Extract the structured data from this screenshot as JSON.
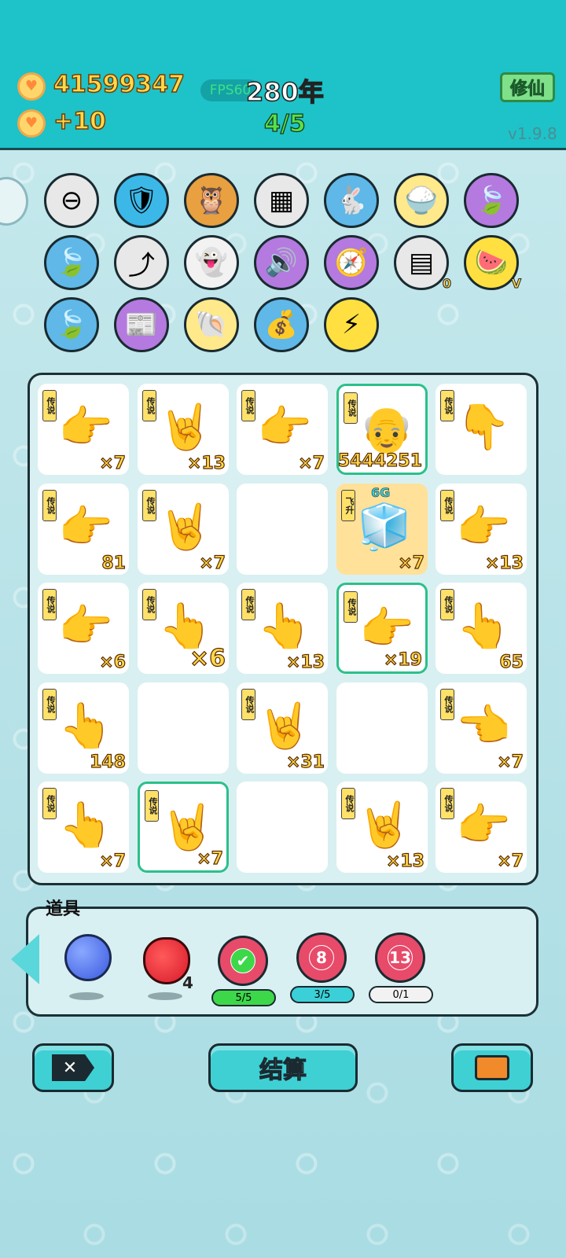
{
  "header": {
    "coins": "41599347",
    "coin_rate": "+10",
    "fps": "FPS60",
    "year": "280年",
    "progress": "4/5",
    "cultivate_button": "修仙",
    "version": "v1.9.8"
  },
  "skills": [
    {
      "icon": "minus-circle-icon",
      "glyph": "⊖",
      "bg": "#e8e8e8"
    },
    {
      "icon": "shield-wrench-icon",
      "glyph": "🛡",
      "bg": "#3bb8e8"
    },
    {
      "icon": "owl-glasses-icon",
      "glyph": "🦉",
      "bg": "#e8a040"
    },
    {
      "icon": "cubes-icon",
      "glyph": "▦",
      "bg": "#e8e8e8"
    },
    {
      "icon": "rabbit-icon",
      "glyph": "🐇",
      "bg": "#5fb8e8"
    },
    {
      "icon": "rice-bowl-icon",
      "glyph": "🍚",
      "bg": "#ffe98a"
    },
    {
      "icon": "leaf-icon",
      "glyph": "🍃",
      "bg": "#b47ae0"
    },
    {
      "icon": "leaf-icon",
      "glyph": "🍃",
      "bg": "#5fb8e8"
    },
    {
      "icon": "arrow-up-icon",
      "glyph": "⤴",
      "bg": "#e8e8e8"
    },
    {
      "icon": "ghost-icon",
      "glyph": "👻",
      "bg": "#f2f2f2"
    },
    {
      "icon": "speaker-ghost-icon",
      "glyph": "🔊",
      "bg": "#b47ae0"
    },
    {
      "icon": "compass-icon",
      "glyph": "🧭",
      "bg": "#b47ae0"
    },
    {
      "icon": "egg-tray-icon",
      "glyph": "▤",
      "bg": "#e8e8e8",
      "badge": "0"
    },
    {
      "icon": "fruit-basket-icon",
      "glyph": "🍉",
      "bg": "#ffe040",
      "badge": "V"
    },
    {
      "icon": "leaf-icon",
      "glyph": "🍃",
      "bg": "#5fb8e8"
    },
    {
      "icon": "time-magazine-icon",
      "glyph": "📰",
      "bg": "#b47ae0"
    },
    {
      "icon": "shell-icon",
      "glyph": "🐚",
      "bg": "#ffe98a"
    },
    {
      "icon": "money-bag-icon",
      "glyph": "💰",
      "bg": "#5fb8e8"
    },
    {
      "icon": "lightning-icon",
      "glyph": "⚡",
      "bg": "#ffe040"
    }
  ],
  "board": [
    [
      {
        "tag": "传说",
        "hand": "👉",
        "count": "×7"
      },
      {
        "tag": "传说",
        "hand": "🤘",
        "count": "×13"
      },
      {
        "tag": "传说",
        "hand": "👉",
        "count": "×7"
      },
      {
        "tag": "传说",
        "hand": "👴",
        "count": "5444251",
        "hl": true
      },
      {
        "tag": "传说",
        "hand": "👇",
        "count": ""
      }
    ],
    [
      {
        "tag": "传说",
        "hand": "👉",
        "count": "81"
      },
      {
        "tag": "传说",
        "hand": "🤘",
        "count": "×7"
      },
      {
        "tag": "",
        "hand": "",
        "count": ""
      },
      {
        "tag": "飞升",
        "hand": "🧊",
        "count": "×7",
        "gold": true,
        "extra": "6G"
      },
      {
        "tag": "传说",
        "hand": "👉",
        "count": "×13"
      }
    ],
    [
      {
        "tag": "传说",
        "hand": "👉",
        "count": "×6"
      },
      {
        "tag": "传说",
        "hand": "👆",
        "count": "×6",
        "big": true
      },
      {
        "tag": "传说",
        "hand": "👆",
        "count": "×13"
      },
      {
        "tag": "传说",
        "hand": "👉",
        "count": "×19",
        "hl": true
      },
      {
        "tag": "传说",
        "hand": "👆",
        "count": "65"
      }
    ],
    [
      {
        "tag": "传说",
        "hand": "👆",
        "count": "148"
      },
      {
        "tag": "",
        "hand": "",
        "count": ""
      },
      {
        "tag": "传说",
        "hand": "🤘",
        "count": "×31"
      },
      {
        "tag": "",
        "hand": "",
        "count": ""
      },
      {
        "tag": "传说",
        "hand": "👈",
        "count": "×7"
      }
    ],
    [
      {
        "tag": "传说",
        "hand": "👆",
        "count": "×7"
      },
      {
        "tag": "传说",
        "hand": "🤘",
        "count": "×7",
        "hl": true
      },
      {
        "tag": "",
        "hand": "",
        "count": ""
      },
      {
        "tag": "传说",
        "hand": "🤘",
        "count": "×13"
      },
      {
        "tag": "传说",
        "hand": "👉",
        "count": "×7"
      }
    ]
  ],
  "props": {
    "title": "道具",
    "strawberry_count": "4",
    "pills": [
      {
        "label": "5/5",
        "color": "#3cd84a"
      },
      {
        "label": "3/5",
        "color": "#3bd0d8"
      },
      {
        "label": "0/1",
        "color": "#f2f2f2"
      }
    ],
    "targets": [
      "8",
      "13"
    ]
  },
  "actions": {
    "settle_label": "结算"
  },
  "colors": {
    "accent": "#1dc3c8",
    "coin": "#ffd94a"
  }
}
